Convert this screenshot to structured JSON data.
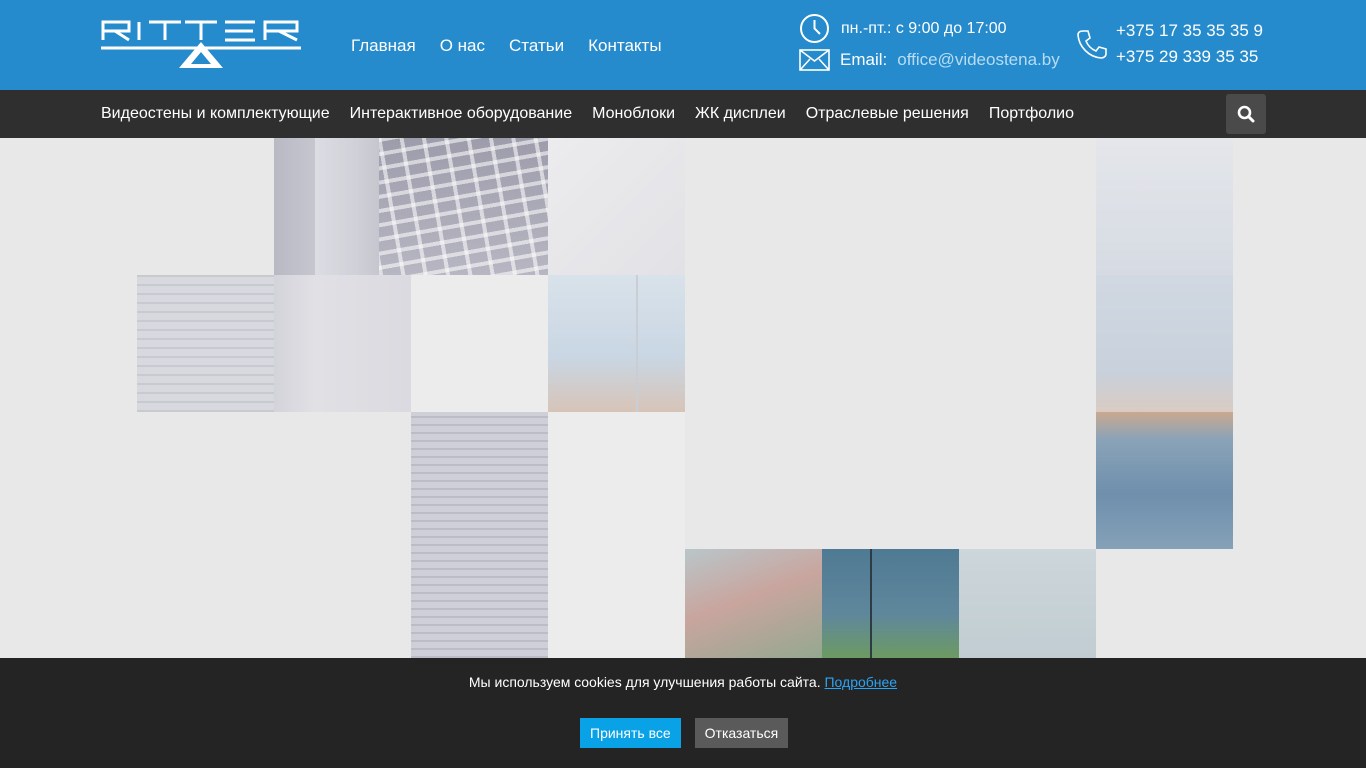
{
  "header": {
    "logo_text": "RITTER",
    "nav": [
      "Главная",
      "О нас",
      "Статьи",
      "Контакты"
    ],
    "hours": "пн.-пт.: с 9:00 до 17:00",
    "email_label": "Email:",
    "email": "office@videostena.by",
    "phones": [
      "+375 17 35 35 35 9",
      "+375 29 339 35 35"
    ]
  },
  "subnav": {
    "items": [
      "Видеостены и комплектующие",
      "Интерактивное оборудование",
      "Моноблоки",
      "ЖК дисплеи",
      "Отраслевые решения",
      "Портфолио"
    ],
    "search_icon": "search-icon"
  },
  "cookie": {
    "text": "Мы используем cookies для улучшения работы сайта.",
    "link": "Подробнее",
    "accept": "Принять все",
    "reject": "Отказаться"
  },
  "colors": {
    "header_bg": "#258bcc",
    "subnav_bg": "#2f2f2f",
    "cookie_bg": "#242424",
    "accept_btn": "#0aa2e6"
  }
}
